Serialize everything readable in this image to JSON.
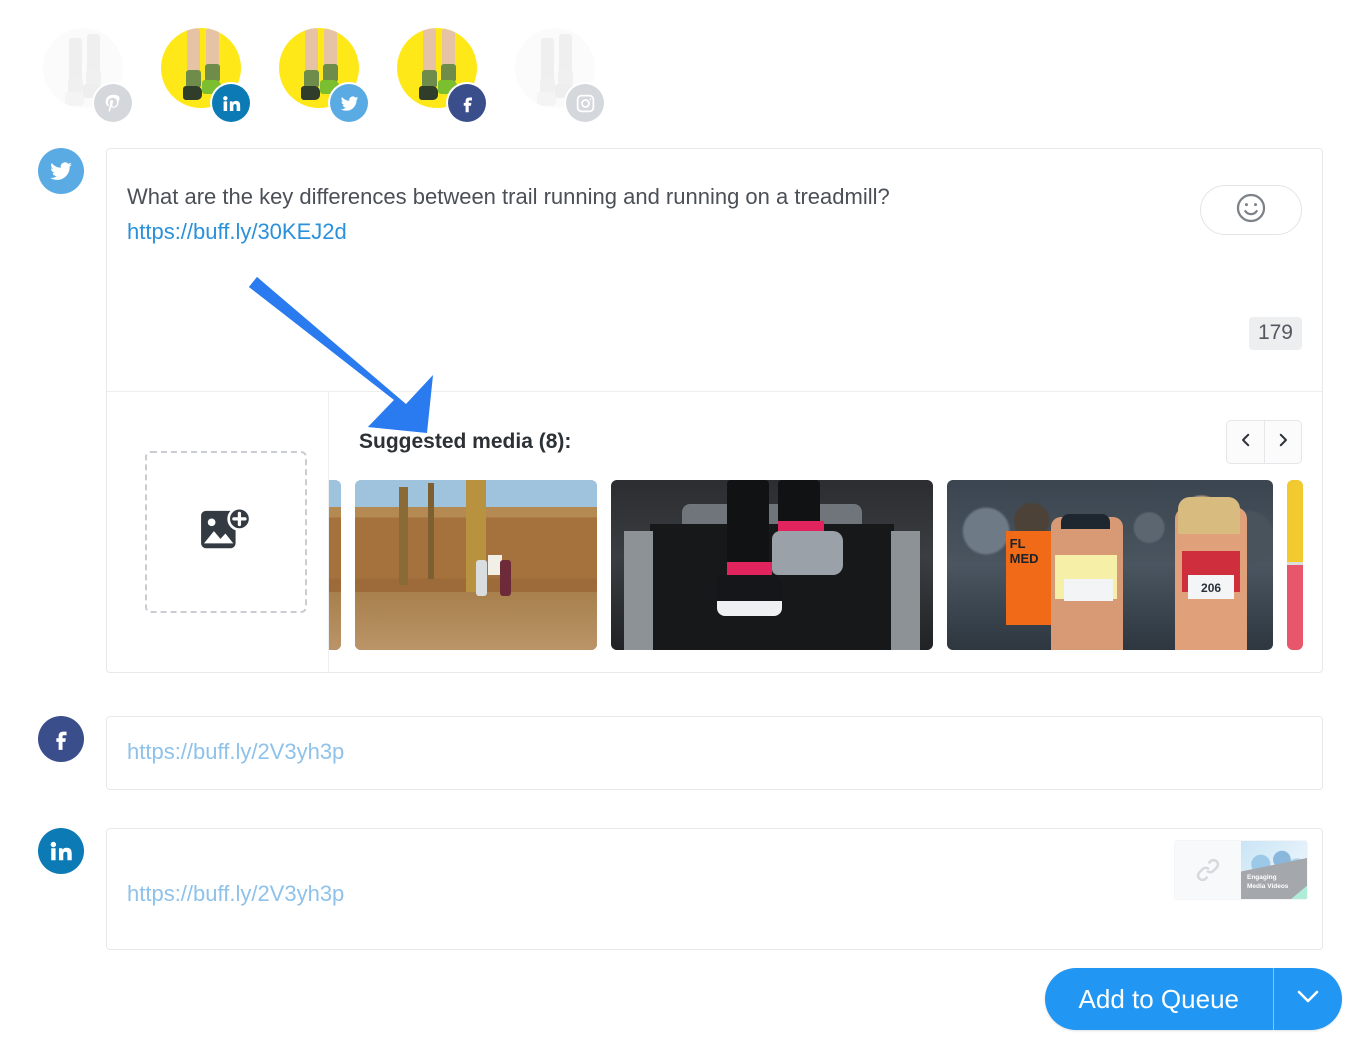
{
  "profiles": [
    {
      "network": "pinterest",
      "name": "pinterest-profile",
      "enabled": false,
      "color": "#d4d7db"
    },
    {
      "network": "linkedin",
      "name": "linkedin-profile",
      "enabled": true,
      "color": "#0c7bb5"
    },
    {
      "network": "twitter",
      "name": "twitter-profile",
      "enabled": true,
      "color": "#5aabe3"
    },
    {
      "network": "facebook",
      "name": "facebook-profile",
      "enabled": true,
      "color": "#3b4e8c"
    },
    {
      "network": "instagram",
      "name": "instagram-profile",
      "enabled": false,
      "color": "#d4d7db"
    }
  ],
  "twitter": {
    "network": "twitter",
    "text": "What are the key differences between trail running and running on a treadmill?",
    "url": "https://buff.ly/30KEJ2d",
    "char_count": "179",
    "emoji_icon": "smiley-icon"
  },
  "media": {
    "upload_icon": "add-image-icon",
    "suggested_title": "Suggested media (8):",
    "prev_icon": "chevron-left-icon",
    "next_icon": "chevron-right-icon",
    "thumbnails": [
      {
        "name": "thumb-partial-left",
        "alt": "partial thumbnail"
      },
      {
        "name": "thumb-trail-runners",
        "alt": "two runners on an autumn forest trail"
      },
      {
        "name": "thumb-treadmill-shoes",
        "alt": "running shoes on a treadmill belt"
      },
      {
        "name": "thumb-race-runners",
        "alt": "marathon runners with race bibs in a crowd"
      },
      {
        "name": "thumb-partial-right",
        "alt": "partial thumbnail"
      }
    ],
    "race_vest_text": "FL\nMED",
    "race_bib_number": "206"
  },
  "facebook": {
    "network": "facebook",
    "url": "https://buff.ly/2V3yh3p"
  },
  "linkedin": {
    "network": "linkedin",
    "url": "https://buff.ly/2V3yh3p",
    "link_preview": {
      "icon": "link-icon",
      "caption": "Engaging\nMedia Videos"
    }
  },
  "footer": {
    "add_to_queue_label": "Add to Queue",
    "caret_icon": "chevron-down-icon",
    "accent_color": "#2196f3"
  },
  "annotation": {
    "arrow_color": "#2a7bf0",
    "name": "annotation-arrow"
  }
}
